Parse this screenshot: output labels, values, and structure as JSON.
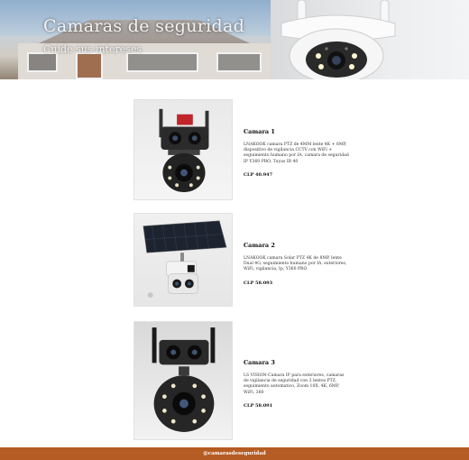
{
  "hero": {
    "title": "Camaras de seguridad",
    "subtitle": "Cuide sus intereses"
  },
  "products": [
    {
      "name": "Camara 1",
      "description": "LNAKOOK camara PTZ de 4MM lente 4K + 8MP, dispositivo de vigilancia CCTV con WiFi + seguimiento humano por IA, camara de seguridad IP Y360 PRO, Tuyas IR 40",
      "price": "CLP 40.947"
    },
    {
      "name": "Camara 2",
      "description": "LNAKOOK camara Solar PTZ 4K de 8MP, lente Dual 4G, seguimiento humano por IA, exteriores, WiFi, vigilancia, Ip, Y360 PRO",
      "price": "CLP 58.093"
    },
    {
      "name": "Camara 3",
      "description": "LS VISION-Camara IP para exteriores, camaras de vigilancia de seguridad con 3 lentes PTZ, seguimiento automatico, Zoom 10X, 4K, 6MP, WiFi, 360",
      "price": "CLP 58.091"
    }
  ],
  "footer": {
    "text": "@camarasdeseguridad"
  },
  "colors": {
    "footer_bg": "#b45c23",
    "hero_text": "#f4f4f4"
  }
}
